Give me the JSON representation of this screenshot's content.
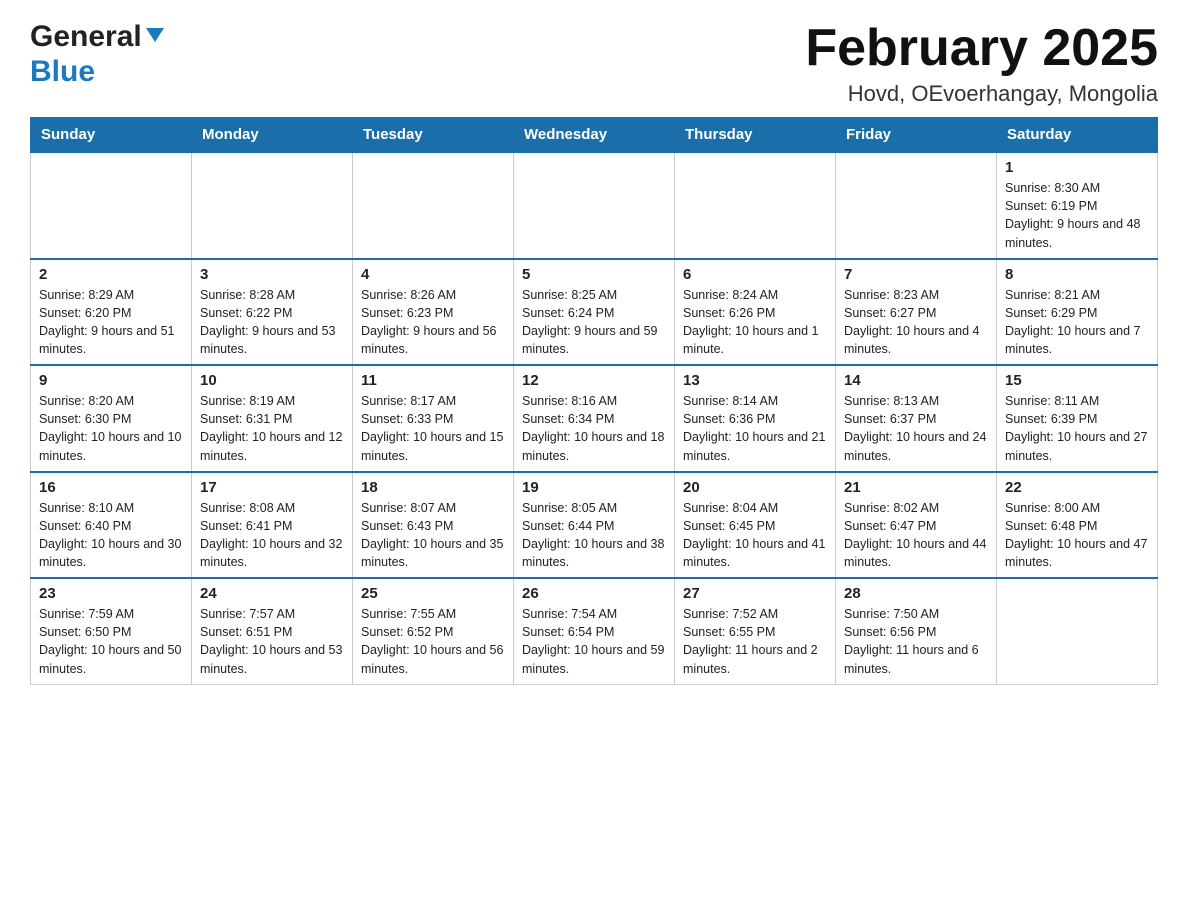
{
  "header": {
    "logo_general": "General",
    "logo_blue": "Blue",
    "month_title": "February 2025",
    "location": "Hovd, OEvoerhangay, Mongolia"
  },
  "weekdays": [
    "Sunday",
    "Monday",
    "Tuesday",
    "Wednesday",
    "Thursday",
    "Friday",
    "Saturday"
  ],
  "weeks": [
    [
      {
        "day": "",
        "info": ""
      },
      {
        "day": "",
        "info": ""
      },
      {
        "day": "",
        "info": ""
      },
      {
        "day": "",
        "info": ""
      },
      {
        "day": "",
        "info": ""
      },
      {
        "day": "",
        "info": ""
      },
      {
        "day": "1",
        "info": "Sunrise: 8:30 AM\nSunset: 6:19 PM\nDaylight: 9 hours and 48 minutes."
      }
    ],
    [
      {
        "day": "2",
        "info": "Sunrise: 8:29 AM\nSunset: 6:20 PM\nDaylight: 9 hours and 51 minutes."
      },
      {
        "day": "3",
        "info": "Sunrise: 8:28 AM\nSunset: 6:22 PM\nDaylight: 9 hours and 53 minutes."
      },
      {
        "day": "4",
        "info": "Sunrise: 8:26 AM\nSunset: 6:23 PM\nDaylight: 9 hours and 56 minutes."
      },
      {
        "day": "5",
        "info": "Sunrise: 8:25 AM\nSunset: 6:24 PM\nDaylight: 9 hours and 59 minutes."
      },
      {
        "day": "6",
        "info": "Sunrise: 8:24 AM\nSunset: 6:26 PM\nDaylight: 10 hours and 1 minute."
      },
      {
        "day": "7",
        "info": "Sunrise: 8:23 AM\nSunset: 6:27 PM\nDaylight: 10 hours and 4 minutes."
      },
      {
        "day": "8",
        "info": "Sunrise: 8:21 AM\nSunset: 6:29 PM\nDaylight: 10 hours and 7 minutes."
      }
    ],
    [
      {
        "day": "9",
        "info": "Sunrise: 8:20 AM\nSunset: 6:30 PM\nDaylight: 10 hours and 10 minutes."
      },
      {
        "day": "10",
        "info": "Sunrise: 8:19 AM\nSunset: 6:31 PM\nDaylight: 10 hours and 12 minutes."
      },
      {
        "day": "11",
        "info": "Sunrise: 8:17 AM\nSunset: 6:33 PM\nDaylight: 10 hours and 15 minutes."
      },
      {
        "day": "12",
        "info": "Sunrise: 8:16 AM\nSunset: 6:34 PM\nDaylight: 10 hours and 18 minutes."
      },
      {
        "day": "13",
        "info": "Sunrise: 8:14 AM\nSunset: 6:36 PM\nDaylight: 10 hours and 21 minutes."
      },
      {
        "day": "14",
        "info": "Sunrise: 8:13 AM\nSunset: 6:37 PM\nDaylight: 10 hours and 24 minutes."
      },
      {
        "day": "15",
        "info": "Sunrise: 8:11 AM\nSunset: 6:39 PM\nDaylight: 10 hours and 27 minutes."
      }
    ],
    [
      {
        "day": "16",
        "info": "Sunrise: 8:10 AM\nSunset: 6:40 PM\nDaylight: 10 hours and 30 minutes."
      },
      {
        "day": "17",
        "info": "Sunrise: 8:08 AM\nSunset: 6:41 PM\nDaylight: 10 hours and 32 minutes."
      },
      {
        "day": "18",
        "info": "Sunrise: 8:07 AM\nSunset: 6:43 PM\nDaylight: 10 hours and 35 minutes."
      },
      {
        "day": "19",
        "info": "Sunrise: 8:05 AM\nSunset: 6:44 PM\nDaylight: 10 hours and 38 minutes."
      },
      {
        "day": "20",
        "info": "Sunrise: 8:04 AM\nSunset: 6:45 PM\nDaylight: 10 hours and 41 minutes."
      },
      {
        "day": "21",
        "info": "Sunrise: 8:02 AM\nSunset: 6:47 PM\nDaylight: 10 hours and 44 minutes."
      },
      {
        "day": "22",
        "info": "Sunrise: 8:00 AM\nSunset: 6:48 PM\nDaylight: 10 hours and 47 minutes."
      }
    ],
    [
      {
        "day": "23",
        "info": "Sunrise: 7:59 AM\nSunset: 6:50 PM\nDaylight: 10 hours and 50 minutes."
      },
      {
        "day": "24",
        "info": "Sunrise: 7:57 AM\nSunset: 6:51 PM\nDaylight: 10 hours and 53 minutes."
      },
      {
        "day": "25",
        "info": "Sunrise: 7:55 AM\nSunset: 6:52 PM\nDaylight: 10 hours and 56 minutes."
      },
      {
        "day": "26",
        "info": "Sunrise: 7:54 AM\nSunset: 6:54 PM\nDaylight: 10 hours and 59 minutes."
      },
      {
        "day": "27",
        "info": "Sunrise: 7:52 AM\nSunset: 6:55 PM\nDaylight: 11 hours and 2 minutes."
      },
      {
        "day": "28",
        "info": "Sunrise: 7:50 AM\nSunset: 6:56 PM\nDaylight: 11 hours and 6 minutes."
      },
      {
        "day": "",
        "info": ""
      }
    ]
  ]
}
